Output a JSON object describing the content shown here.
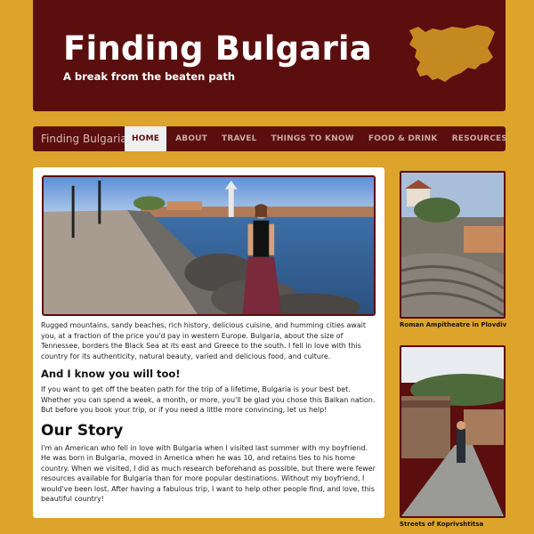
{
  "header": {
    "title": "Finding Bulgaria",
    "tagline": "A break from the beaten path",
    "logo_icon": "bulgaria-map-icon"
  },
  "nav": {
    "brand": "Finding Bulgaria",
    "items": [
      {
        "label": "HOME",
        "active": true
      },
      {
        "label": "ABOUT"
      },
      {
        "label": "TRAVEL"
      },
      {
        "label": "THINGS TO KNOW"
      },
      {
        "label": "FOOD & DRINK"
      },
      {
        "label": "RESOURCES"
      }
    ]
  },
  "main": {
    "intro": "Rugged mountains, sandy beaches, rich history, delicious cuisine, and humming cities await you, at a fraction of the price you'd pay in western Europe. Bulgaria, about the size of Tennessee, borders the Black Sea at its east and Greece to the south. I fell in love with this country for its authenticity, natural beauty, varied and delicious food, and culture.",
    "subheading": "And I know you will too!",
    "subtext": "If you want to get off the beaten path for the trip of a lifetime, Bulgaria is your best bet. Whether you can spend a week, a month, or more, you'll be glad you chose this Balkan nation. But before you book your trip, or if you need a little more convincing, let us help!",
    "story_heading": "Our Story",
    "story_text": "I'm an American who fell in love with Bulgaria when I visited last summer with my boyfriend. He was born in Bulgaria, moved in America when he was 10, and retains ties to his home country. When we visited, I did as much research beforehand as possible, but there were fewer resources available for Bulgaria than for more popular destinations. Without my boyfriend, I would've been lost. After having a fabulous trip, I want to help other people find, and love, this beautiful country!"
  },
  "sidebar": {
    "photo1_caption": "Roman Ampitheatre in Plovdiv",
    "photo2_caption": "Streets of Koprivshtitsa"
  },
  "colors": {
    "background": "#dca42a",
    "brand": "#5a0e0e",
    "nav_text": "#c9a8a0"
  }
}
